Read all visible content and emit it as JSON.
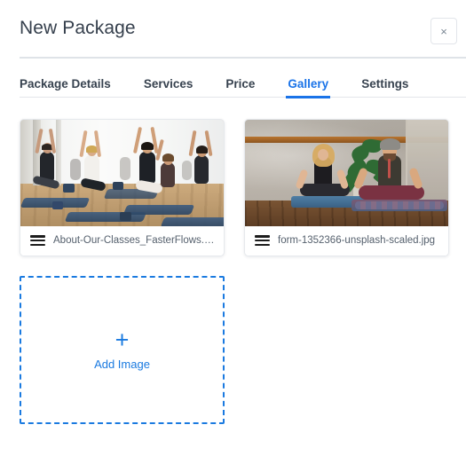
{
  "modal": {
    "title": "New Package",
    "close_label": "×",
    "close_icon": "close-icon"
  },
  "tabs": {
    "items": [
      {
        "label": "Package Details",
        "active": false
      },
      {
        "label": "Services",
        "active": false
      },
      {
        "label": "Price",
        "active": false
      },
      {
        "label": "Gallery",
        "active": true
      },
      {
        "label": "Settings",
        "active": false
      }
    ]
  },
  "gallery": {
    "images": [
      {
        "filename": "About-Our-Classes_FasterFlows.jpg",
        "alt": "Yoga class in bright studio with raised arms",
        "drag_icon": "drag-handle-icon"
      },
      {
        "filename": "form-1352366-unsplash-scaled.jpg",
        "alt": "Two people meditating cross-legged on mats",
        "drag_icon": "drag-handle-icon"
      }
    ],
    "add_tile": {
      "plus": "+",
      "label": "Add Image",
      "plus_icon": "plus-icon"
    }
  },
  "colors": {
    "accent": "#1a73e8",
    "add_border": "#1a7ae0",
    "title": "#36404d",
    "tab_text": "#37424f",
    "caption_text": "#55606d",
    "divider": "#dfe3e8",
    "card_border": "#e6e9ed"
  }
}
